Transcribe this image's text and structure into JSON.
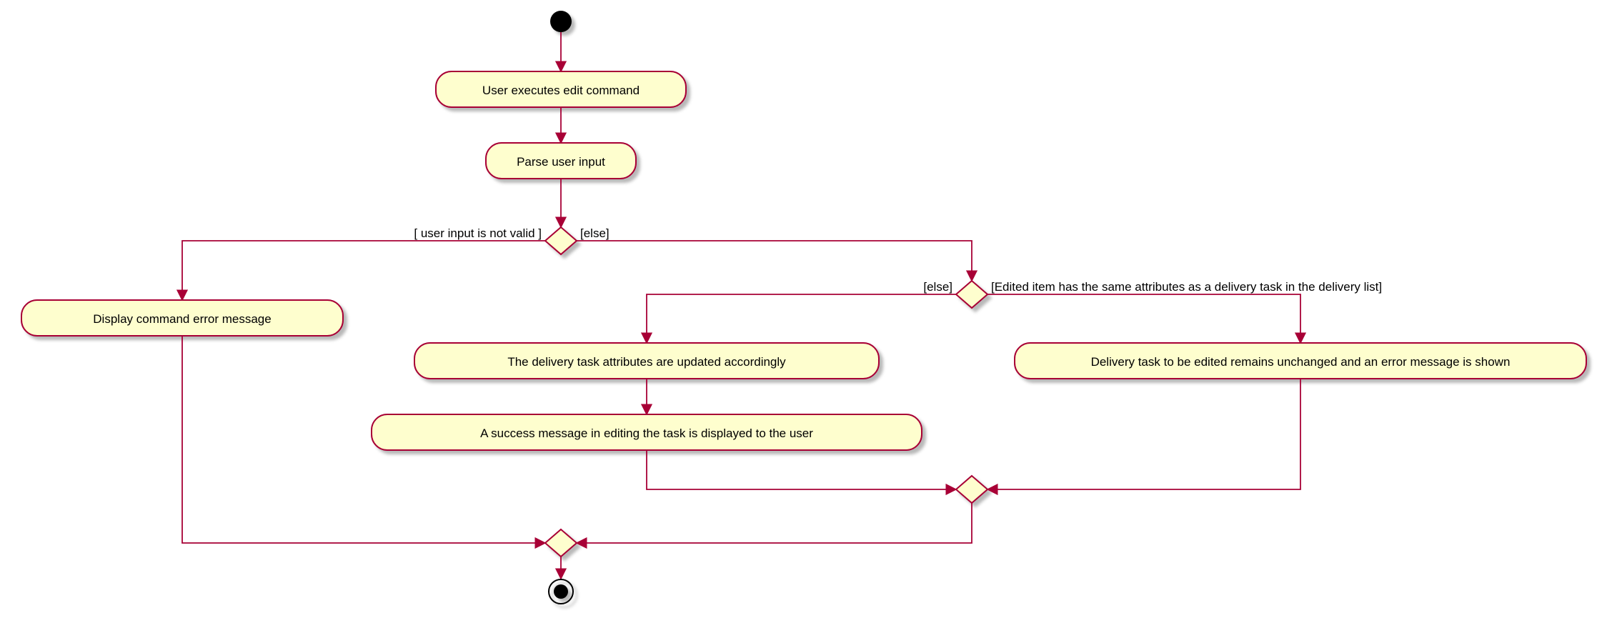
{
  "chart_data": {
    "type": "uml-activity",
    "nodes": {
      "start": {
        "kind": "initial"
      },
      "a1": {
        "kind": "activity",
        "label": "User executes edit command"
      },
      "a2": {
        "kind": "activity",
        "label": "Parse user input"
      },
      "d1": {
        "kind": "decision"
      },
      "a3": {
        "kind": "activity",
        "label": "Display command error message"
      },
      "d2": {
        "kind": "decision"
      },
      "a4": {
        "kind": "activity",
        "label": "The delivery task attributes are updated accordingly"
      },
      "a5": {
        "kind": "activity",
        "label": "A success message in editing the task is displayed to the user"
      },
      "a6": {
        "kind": "activity",
        "label": "Delivery task to be edited remains unchanged and an error message is shown"
      },
      "m2": {
        "kind": "merge"
      },
      "m1": {
        "kind": "merge"
      },
      "end": {
        "kind": "final"
      }
    },
    "edges": [
      {
        "from": "start",
        "to": "a1"
      },
      {
        "from": "a1",
        "to": "a2"
      },
      {
        "from": "a2",
        "to": "d1"
      },
      {
        "from": "d1",
        "to": "a3",
        "guard": "[ user input is not valid ]"
      },
      {
        "from": "d1",
        "to": "d2",
        "guard": "[else]"
      },
      {
        "from": "d2",
        "to": "a4",
        "guard": "[else]"
      },
      {
        "from": "d2",
        "to": "a6",
        "guard": "[Edited item has the same attributes as a delivery task in the delivery list]"
      },
      {
        "from": "a4",
        "to": "a5"
      },
      {
        "from": "a5",
        "to": "m2"
      },
      {
        "from": "a6",
        "to": "m2"
      },
      {
        "from": "m2",
        "to": "m1"
      },
      {
        "from": "a3",
        "to": "m1"
      },
      {
        "from": "m1",
        "to": "end"
      }
    ]
  },
  "labels": {
    "a1": "User executes edit command",
    "a2": "Parse user input",
    "a3": "Display command error message",
    "a4": "The delivery task attributes are updated accordingly",
    "a5": "A success message in editing the task is displayed to the user",
    "a6": "Delivery task to be edited remains unchanged and an error message is shown",
    "g_d1_left": "[ user input is not valid ]",
    "g_d1_right": "[else]",
    "g_d2_left": "[else]",
    "g_d2_right": "[Edited item has the same attributes as a delivery task in the delivery list]"
  }
}
